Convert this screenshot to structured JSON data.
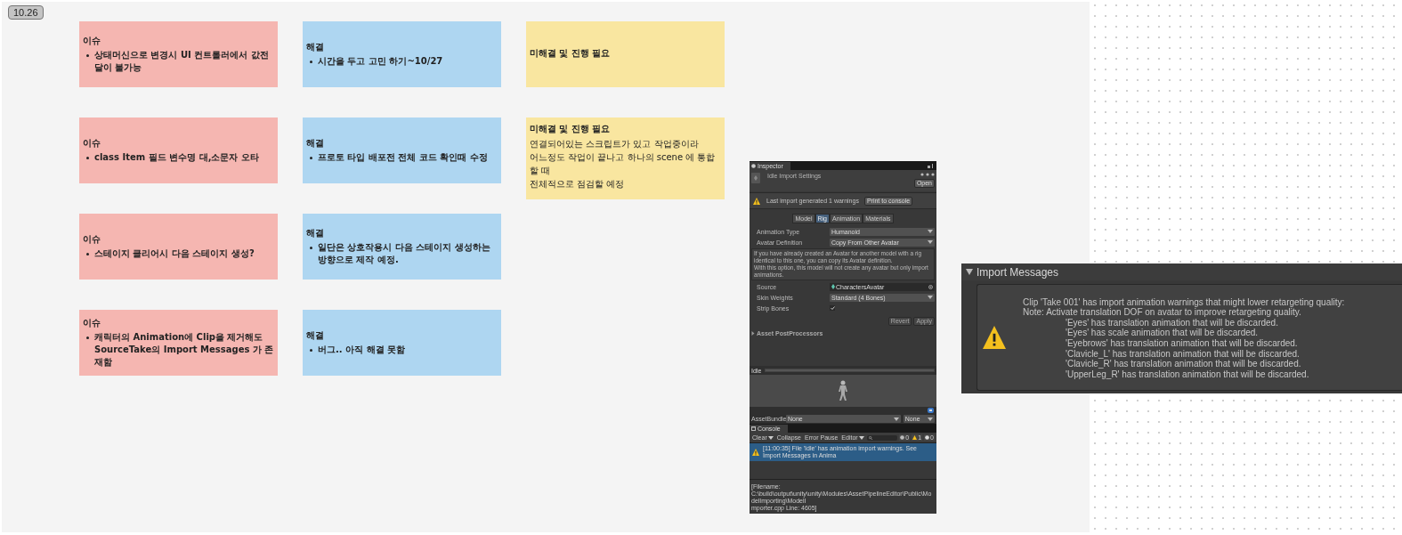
{
  "section": {
    "label": "10.26"
  },
  "rows": [
    {
      "notes": [
        {
          "kind": "issue",
          "title": "이슈",
          "bullets": [
            "상태머신으로 변경시 UI 컨트롤러에서 값전달이 불가능"
          ]
        },
        {
          "kind": "solution",
          "title": "해결",
          "bullets": [
            "시간을 두고 고민 하기~10/27"
          ]
        },
        {
          "kind": "pending",
          "title": "미해결 및 진행 필요"
        }
      ]
    },
    {
      "notes": [
        {
          "kind": "issue",
          "title": "이슈",
          "bullets": [
            "class Item 필드 변수명 대,소문자 오타"
          ]
        },
        {
          "kind": "solution",
          "title": "해결",
          "bullets": [
            "프로토 타입 배포전 전체 코드 확인때 수정"
          ]
        },
        {
          "kind": "pending",
          "title": "미해결 및 진행 필요",
          "lines": [
            "연결되어있는 스크립트가 있고 작업중이라",
            "어느정도 작업이 끝나고 하나의 scene 에 통합할 때",
            "전체적으로 점검할 예정"
          ]
        }
      ]
    },
    {
      "notes": [
        {
          "kind": "issue",
          "title": "이슈",
          "bullets": [
            "스테이지 클리어시 다음 스테이지 생성?"
          ]
        },
        {
          "kind": "solution",
          "title": "해결",
          "bullets": [
            "일단은 상호작용시 다음 스테이지 생성하는 방향으로 제작 예정."
          ]
        }
      ]
    },
    {
      "notes": [
        {
          "kind": "issue",
          "title": "이슈",
          "bullets": [
            "캐릭터의 Animation에 Clip을 제거해도 SourceTake의 Import Messages 가 존재함"
          ]
        },
        {
          "kind": "solution",
          "title": "해결",
          "bullets": [
            "버그.. 아직 해결 못함"
          ]
        }
      ]
    }
  ],
  "inspector": {
    "tab": "Inspector",
    "title": "Idle Import Settings",
    "open_button": "Open",
    "warning": "Last import generated 1 warnings",
    "print_button": "Print to console",
    "tabs": [
      {
        "label": "Model",
        "selected": false
      },
      {
        "label": "Rig",
        "selected": true
      },
      {
        "label": "Animation",
        "selected": false
      },
      {
        "label": "Materials",
        "selected": false
      }
    ],
    "fields_top": [
      {
        "kind": "dropdown",
        "label": "Animation Type",
        "value": "Humanoid"
      },
      {
        "kind": "dropdown",
        "label": "Avatar Definition",
        "value": "Copy From Other Avatar"
      }
    ],
    "help_lines": [
      "If you have already created an Avatar for another model with a rig identical to this one, you can copy its Avatar definition.",
      "With this option, this model will not create any avatar but only import animations."
    ],
    "fields_bottom": [
      {
        "kind": "object",
        "label": "Source",
        "value": "CharactersAvatar"
      },
      {
        "kind": "dropdown",
        "label": "Skin Weights",
        "value": "Standard (4 Bones)"
      },
      {
        "kind": "checkbox",
        "label": "Strip Bones",
        "checked": true
      }
    ],
    "buttons": [
      {
        "label": "Revert",
        "disabled": true
      },
      {
        "label": "Apply",
        "disabled": true
      }
    ],
    "foldout": {
      "label": "Asset PostProcessors",
      "expanded": false
    },
    "preview": {
      "label": "Idle"
    },
    "asset_bundle": {
      "label": "AssetBundle",
      "value": "None",
      "variant": "None"
    },
    "console": {
      "tab": "Console",
      "toolbar": [
        "Clear",
        "Collapse",
        "Error Pause",
        "Editor"
      ],
      "counts": [
        {
          "kind": "info",
          "count": "0"
        },
        {
          "kind": "warning",
          "count": "1"
        },
        {
          "kind": "error",
          "count": "0"
        }
      ],
      "entries": [
        {
          "text": "[11:00:35] File 'Idle' has animation import warnings. See Import Messages in Anima",
          "selected": true
        }
      ],
      "detail_lines": [
        "[Filename:",
        "C:\\build\\output\\unity\\unity\\Modules\\AssetPipelineEditor\\Public\\ModelImporting\\ModelI",
        "mporter.cpp Line: 4605]"
      ]
    }
  },
  "import_messages": {
    "title": "Import Messages",
    "expanded": true,
    "lines": [
      {
        "text": "Clip 'Take 001' has import animation warnings that might lower retargeting quality:",
        "indented": false
      },
      {
        "text": "Note: Activate translation DOF on avatar to improve retargeting quality.",
        "indented": false
      },
      {
        "text": "'Eyes' has translation animation that will be discarded.",
        "indented": true
      },
      {
        "text": "'Eyes' has scale animation that will be discarded.",
        "indented": true
      },
      {
        "text": "'Eyebrows' has translation animation that will be discarded.",
        "indented": true
      },
      {
        "text": "'Clavicle_L' has translation animation that will be discarded.",
        "indented": true
      },
      {
        "text": "'Clavicle_R' has translation animation that will be discarded.",
        "indented": true
      },
      {
        "text": "'UpperLeg_R' has translation animation that will be discarded.",
        "indented": true
      }
    ]
  }
}
